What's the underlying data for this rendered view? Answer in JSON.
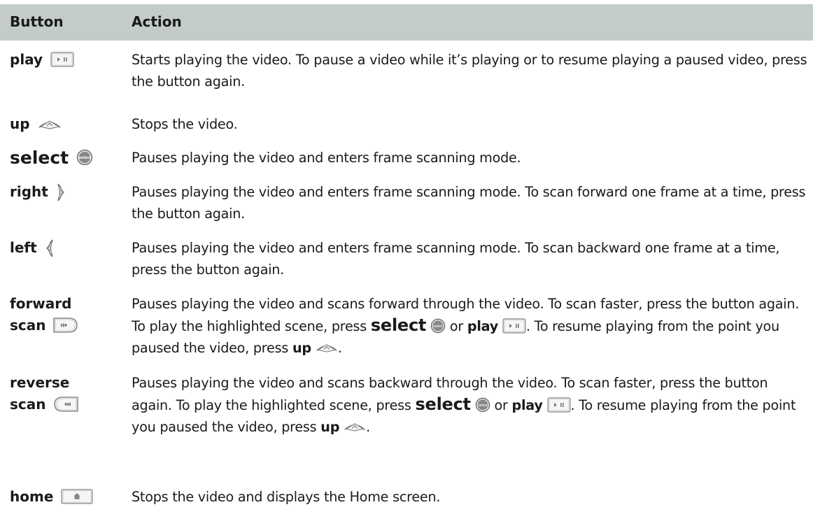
{
  "header": {
    "button_col": "Button",
    "action_col": "Action"
  },
  "rows": [
    {
      "button": "play",
      "icon": "play-pause-icon",
      "text": "Starts playing the video. To pause a video while it’s playing or to resume playing a paused video, press the button again."
    },
    {
      "button": "up",
      "icon": "up-arrow-icon",
      "text": "Stops the video."
    },
    {
      "button": "select",
      "icon": "select-icon",
      "text": "Pauses playing the video and enters frame scanning mode."
    },
    {
      "button": "right",
      "icon": "right-arrow-icon",
      "text": "Pauses playing the video and enters frame scanning mode. To scan forward one frame at a time, press the button again."
    },
    {
      "button": "left",
      "icon": "left-arrow-icon",
      "text": "Pauses playing the video and enters frame scanning mode. To scan backward one frame at a time, press the button again."
    },
    {
      "button_line1": "forward",
      "button_line2": "scan",
      "icon": "forward-scan-icon",
      "text_a": "Pauses playing the video and scans forward through the video. To scan faster, press the button again. To play the highlighted scene, press",
      "kw_select": "select",
      "kw_or": "or",
      "kw_play": "play",
      "text_b": ". To resume playing from the point you paused the video, press",
      "kw_up": "up",
      "text_c": "."
    },
    {
      "button_line1": "reverse",
      "button_line2": "scan",
      "icon": "reverse-scan-icon",
      "text_a": "Pauses playing the video and scans backward through the video. To scan faster, press the button again. To play the highlighted scene, press",
      "kw_select": "select",
      "kw_or": "or",
      "kw_play": "play",
      "text_b": ". To resume playing from the point you paused the video, press",
      "kw_up": "up",
      "text_c": "."
    },
    {
      "button": "home",
      "icon": "home-icon",
      "text": "Stops the video and displays the Home screen."
    }
  ],
  "icon_text": {
    "select_icon": "select"
  }
}
